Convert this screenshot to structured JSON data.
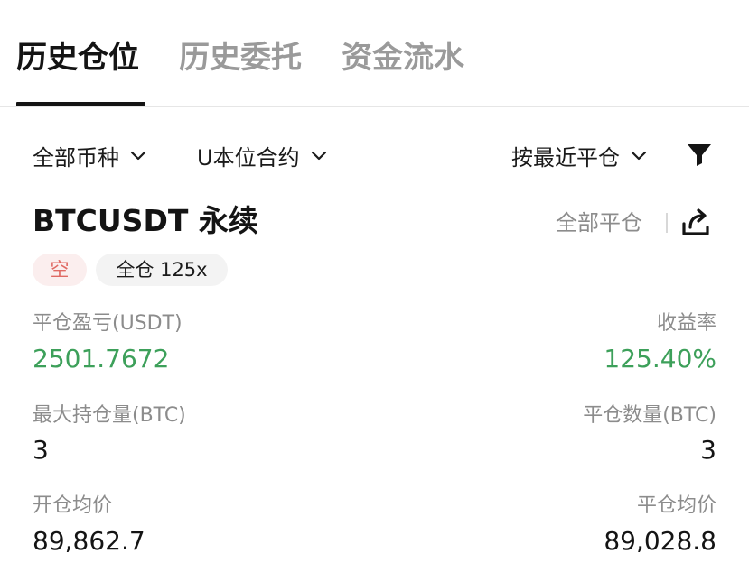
{
  "tabs": [
    {
      "label": "历史仓位",
      "active": true
    },
    {
      "label": "历史委托",
      "active": false
    },
    {
      "label": "资金流水",
      "active": false
    }
  ],
  "filters": {
    "coin": "全部币种",
    "contract": "U本位合约",
    "sort": "按最近平仓"
  },
  "icons": {
    "chevron": "chevron-down-icon",
    "filter": "funnel-icon",
    "share": "share-icon"
  },
  "position": {
    "symbol": "BTCUSDT 永续",
    "close_all": "全部平仓",
    "side": "空",
    "margin_mode": "全仓 125x",
    "pnl_label": "平仓盈亏(USDT)",
    "pnl_value": "2501.7672",
    "roi_label": "收益率",
    "roi_value": "125.40%",
    "max_pos_label": "最大持仓量(BTC)",
    "max_pos_value": "3",
    "closed_qty_label": "平仓数量(BTC)",
    "closed_qty_value": "3",
    "open_price_label": "开仓均价",
    "open_price_value": "89,862.7",
    "close_price_label": "平仓均价",
    "close_price_value": "89,028.8"
  },
  "colors": {
    "profit": "#3da05a",
    "short_text": "#e06a64",
    "short_bg": "#fbeeee",
    "muted": "#8c8c8c",
    "active_tab": "#141414",
    "inactive_tab": "#9a9a9a"
  }
}
